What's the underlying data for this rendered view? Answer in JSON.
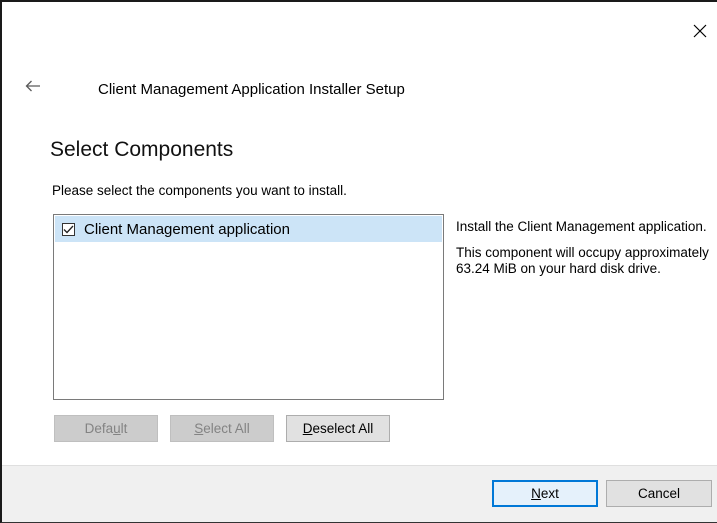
{
  "window": {
    "title": "Client Management Application Installer Setup"
  },
  "page": {
    "heading": "Select Components",
    "instructions": "Please select the components you want to install."
  },
  "components": {
    "items": [
      {
        "label": "Client Management application",
        "checked": true,
        "selected": true
      }
    ]
  },
  "description": {
    "line1": "Install the Client Management application.",
    "line2": "This component will occupy approximately 63.24 MiB on your hard disk drive."
  },
  "list_buttons": {
    "default": {
      "pre": "Defa",
      "accel": "u",
      "post": "lt",
      "enabled": false
    },
    "select_all": {
      "pre": "",
      "accel": "S",
      "post": "elect All",
      "enabled": false
    },
    "deselect_all": {
      "pre": "",
      "accel": "D",
      "post": "eselect All",
      "enabled": true
    }
  },
  "footer_buttons": {
    "next": {
      "pre": "",
      "accel": "N",
      "post": "ext"
    },
    "cancel": {
      "label": "Cancel"
    }
  },
  "icons": {
    "close": "close-icon",
    "back": "back-arrow-icon",
    "check": "checkmark-icon"
  },
  "colors": {
    "accent": "#0078d7",
    "selection": "#cce4f7",
    "footer_bg": "#f0f0f0"
  }
}
